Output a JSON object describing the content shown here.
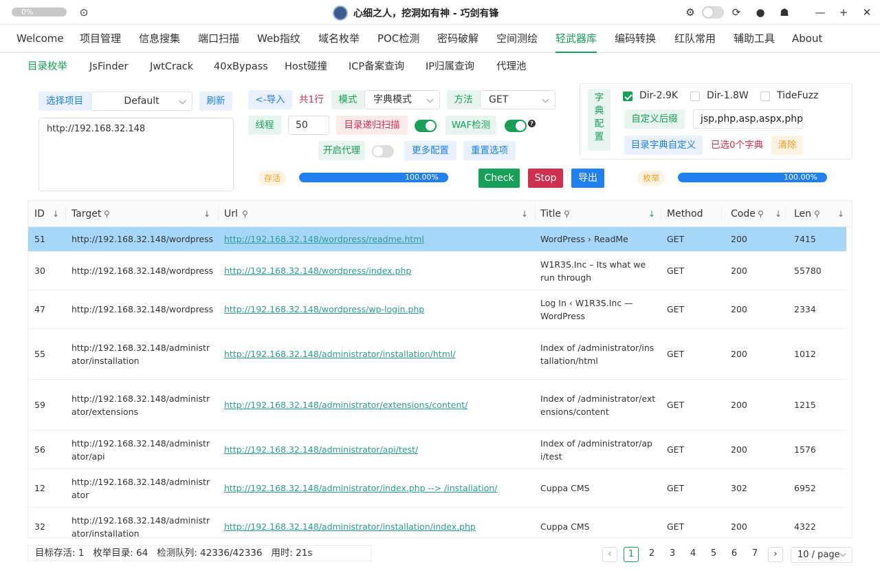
{
  "titlebar": {
    "progress_text": "0%",
    "title": "心细之人，挖洞如有神 - 巧剑有锋"
  },
  "menu": [
    "Welcome",
    "项目管理",
    "信息搜集",
    "端口扫描",
    "Web指纹",
    "域名枚举",
    "POC检测",
    "密码破解",
    "空间测绘",
    "轻武器库",
    "编码转换",
    "红队常用",
    "辅助工具",
    "About"
  ],
  "menu_active": "轻武器库",
  "subtabs": [
    "目录枚举",
    "JsFinder",
    "JwtCrack",
    "40xBypass",
    "Host碰撞",
    "ICP备案查询",
    "IP归属查询",
    "代理池"
  ],
  "subtab_active": "目录枚举",
  "form": {
    "select_project_label": "选择项目",
    "project_value": "Default",
    "refresh_label": "刷新",
    "targets": "http://192.168.32.148",
    "import_label": "<-导入",
    "line_count": "共1行",
    "mode_label": "模式",
    "mode_value": "字典模式",
    "method_label": "方法",
    "method_value": "GET",
    "threads_label": "线程",
    "threads_value": "50",
    "recursive_label": "目录递归扫描",
    "recursive_on": true,
    "waf_label": "WAF检测",
    "waf_on": true,
    "help": "?",
    "proxy_label": "开启代理",
    "proxy_on": false,
    "more_config_label": "更多配置",
    "reset_label": "重置选项"
  },
  "dict": {
    "label": "字典配置",
    "options": [
      {
        "label": "Dir-2.9K",
        "checked": true
      },
      {
        "label": "Dir-1.8W",
        "checked": false
      },
      {
        "label": "TideFuzz",
        "checked": false
      }
    ],
    "custom_suffix_label": "自定义后缀",
    "suffix_value": "jsp,php,asp,aspx,php",
    "custom_dict_label": "目录字典自定义",
    "selected_text": "已选0个字典",
    "clear_label": "清除"
  },
  "progress": {
    "alive_label": "存活",
    "alive_percent": "100.00%",
    "alive_value": 1.0,
    "enum_label": "枚举",
    "enum_percent": "100.00%",
    "enum_value": 1.0
  },
  "actions": {
    "check": "Check",
    "stop": "Stop",
    "export": "导出"
  },
  "table": {
    "columns": [
      "ID",
      "Target",
      "Url",
      "Title",
      "Method",
      "Code",
      "Len"
    ],
    "rows": [
      {
        "id": "51",
        "target": "http://192.168.32.148/wordpress",
        "url": "http://192.168.32.148/wordpress/readme.html",
        "title": "WordPress › ReadMe",
        "method": "GET",
        "code": "200",
        "len": "7415",
        "selected": true
      },
      {
        "id": "30",
        "target": "http://192.168.32.148/wordpress",
        "url": "http://192.168.32.148/wordpress/index.php",
        "title": "W1R3S.Inc – Its what we run through",
        "method": "GET",
        "code": "200",
        "len": "55780"
      },
      {
        "id": "47",
        "target": "http://192.168.32.148/wordpress",
        "url": "http://192.168.32.148/wordpress/wp-login.php",
        "title": "Log In ‹ W1R3S.Inc — WordPress",
        "method": "GET",
        "code": "200",
        "len": "2334"
      },
      {
        "id": "55",
        "target": "http://192.168.32.148/administrator/installation",
        "url": "http://192.168.32.148/administrator/installation/html/",
        "title": "Index of /administrator/installation/html",
        "method": "GET",
        "code": "200",
        "len": "1012"
      },
      {
        "id": "59",
        "target": "http://192.168.32.148/administrator/extensions",
        "url": "http://192.168.32.148/administrator/extensions/content/",
        "title": "Index of /administrator/extensions/content",
        "method": "GET",
        "code": "200",
        "len": "1215"
      },
      {
        "id": "56",
        "target": "http://192.168.32.148/administrator/api",
        "url": "http://192.168.32.148/administrator/api/test/",
        "title": "Index of /administrator/api/test",
        "method": "GET",
        "code": "200",
        "len": "1576"
      },
      {
        "id": "12",
        "target": "http://192.168.32.148/administrator",
        "url": "http://192.168.32.148/administrator/index.php --> /installation/",
        "title": "Cuppa CMS",
        "method": "GET",
        "code": "302",
        "len": "6952"
      },
      {
        "id": "32",
        "target": "http://192.168.32.148/administrator/installation",
        "url": "http://192.168.32.148/administrator/installation/index.php",
        "title": "Cuppa CMS",
        "method": "GET",
        "code": "200",
        "len": "4322"
      }
    ]
  },
  "status": "目标存活: 1   枚举目录: 64   检测队列: 42336/42336   用时: 21s",
  "pagination": {
    "pages": [
      "1",
      "2",
      "3",
      "4",
      "5",
      "6",
      "7"
    ],
    "current": "1",
    "page_size": "10 / page"
  },
  "colors": {
    "accent": "#18a058",
    "info": "#2080f0",
    "danger": "#d03050",
    "warning": "#f0a020",
    "selected_row": "#a6d6f8"
  }
}
